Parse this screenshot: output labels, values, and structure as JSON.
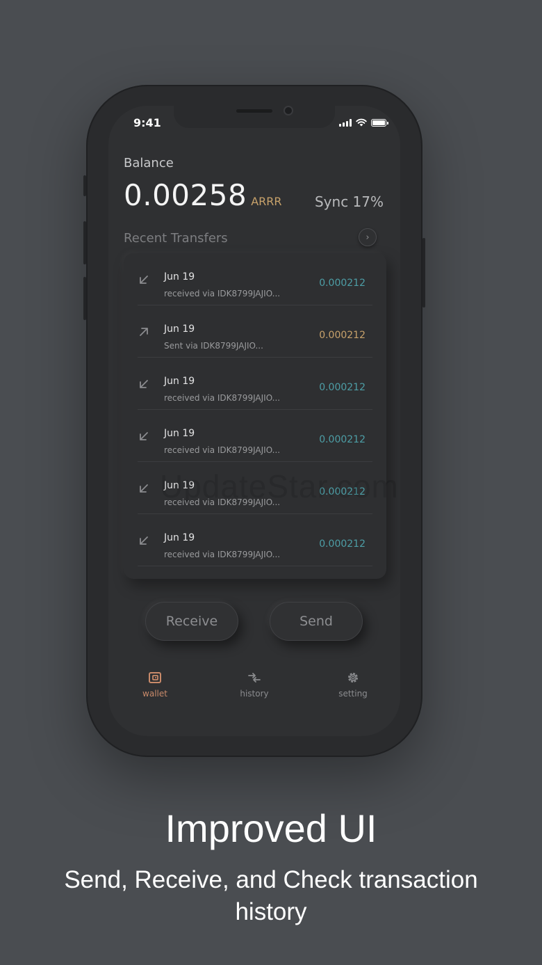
{
  "status_bar": {
    "time": "9:41"
  },
  "wallet": {
    "balance_label": "Balance",
    "balance_value": "0.00258",
    "balance_unit": "ARRR",
    "sync": "Sync 17%",
    "recent_title": "Recent Transfers",
    "more_icon": "chevron-right-icon"
  },
  "transactions": [
    {
      "direction": "in",
      "date": "Jun 19",
      "desc": "received via IDK8799JAJIO...",
      "amount": "0.000212"
    },
    {
      "direction": "out",
      "date": "Jun 19",
      "desc": "Sent via IDK8799JAJIO...",
      "amount": "0.000212"
    },
    {
      "direction": "in",
      "date": "Jun 19",
      "desc": "received via IDK8799JAJIO...",
      "amount": "0.000212"
    },
    {
      "direction": "in",
      "date": "Jun 19",
      "desc": "received via IDK8799JAJIO...",
      "amount": "0.000212"
    },
    {
      "direction": "in",
      "date": "Jun 19",
      "desc": "received via IDK8799JAJIO...",
      "amount": "0.000212"
    },
    {
      "direction": "in",
      "date": "Jun 19",
      "desc": "received via IDK8799JAJIO...",
      "amount": "0.000212"
    }
  ],
  "actions": {
    "receive": "Receive",
    "send": "Send"
  },
  "tabs": [
    {
      "label": "wallet",
      "icon": "wallet-icon",
      "active": true
    },
    {
      "label": "history",
      "icon": "history-icon",
      "active": false
    },
    {
      "label": "setting",
      "icon": "gear-icon",
      "active": false
    }
  ],
  "watermark": "UpdateStar.com",
  "marketing": {
    "headline": "Improved UI",
    "subline": "Send, Receive, and Check transaction history"
  },
  "colors": {
    "background": "#4a4d51",
    "incoming": "#4d9ea6",
    "outgoing": "#c8a26b",
    "active_tab": "#c98a6a"
  }
}
